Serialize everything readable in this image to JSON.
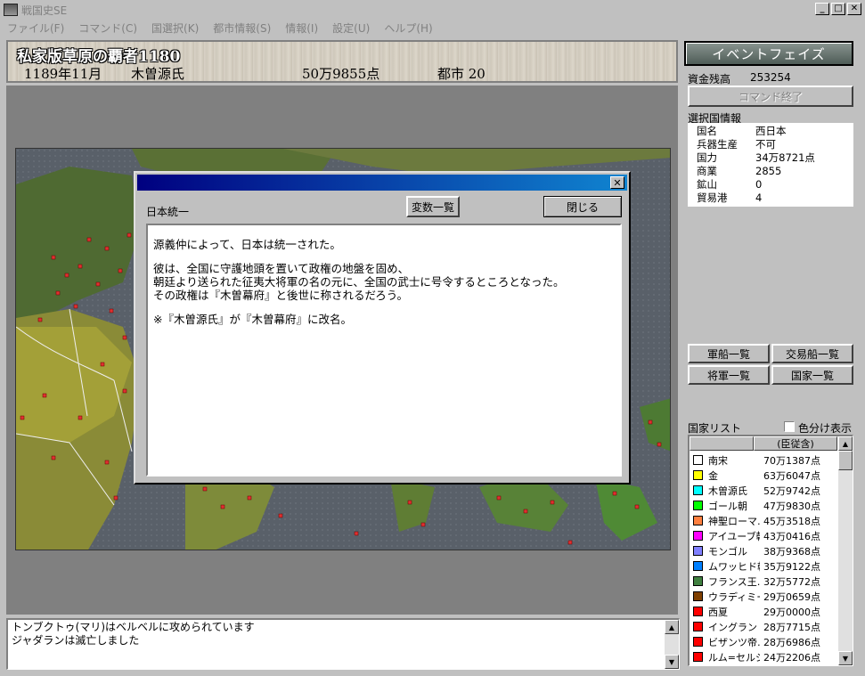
{
  "window": {
    "title": "戦国史SE"
  },
  "menu": [
    "ファイル(F)",
    "コマンド(C)",
    "国選択(K)",
    "都市情報(S)",
    "情報(I)",
    "設定(U)",
    "ヘルプ(H)"
  ],
  "header": {
    "scenario": "私家版草原の覇者1180",
    "date": "1189年11月",
    "clan": "木曽源氏",
    "score": "50万9855点",
    "cities": "都市 20"
  },
  "dialog": {
    "heading": "日本統一",
    "vars_button": "変数一覧",
    "close_button": "閉じる",
    "paragraphs": [
      "源義仲によって、日本は統一された。",
      "彼は、全国に守護地頭を置いて政権の地盤を固め、\n朝廷より送られた征夷大将軍の名の元に、全国の武士に号令するところとなった。\nその政権は『木曽幕府』と後世に称されるだろう。",
      "※『木曽源氏』が『木曽幕府』に改名。"
    ]
  },
  "log": {
    "lines": [
      "トンブクトゥ(マリ)はベルベルに攻められています",
      "ジャダランは滅亡しました"
    ]
  },
  "panel": {
    "phase": "イベントフェイズ",
    "funds_label": "資金残高",
    "funds_value": "253254",
    "end_command": "コマンド終了",
    "country_info_label": "選択国情報",
    "country_info": [
      {
        "key": "国名",
        "value": "西日本"
      },
      {
        "key": "兵器生産",
        "value": "不可"
      },
      {
        "key": "国力",
        "value": "34万8721点"
      },
      {
        "key": "商業",
        "value": "2855"
      },
      {
        "key": "鉱山",
        "value": "0"
      },
      {
        "key": "貿易港",
        "value": "4"
      }
    ],
    "buttons": {
      "warships": "軍船一覧",
      "tradeships": "交易船一覧",
      "generals": "将軍一覧",
      "countries": "国家一覧"
    },
    "country_list_label": "国家リスト",
    "color_toggle_label": "色分け表示",
    "list_header": "(臣従含)",
    "countries": [
      {
        "name": "南宋",
        "value": "70万1387点",
        "color": "#ffffff"
      },
      {
        "name": "金",
        "value": "63万6047点",
        "color": "#ffff00"
      },
      {
        "name": "木曽源氏",
        "value": "52万9742点",
        "color": "#00ffff"
      },
      {
        "name": "ゴール朝",
        "value": "47万9830点",
        "color": "#00ff00"
      },
      {
        "name": "神聖ローマ…",
        "value": "45万3518点",
        "color": "#ff8040"
      },
      {
        "name": "アイユーブ朝",
        "value": "43万0416点",
        "color": "#ff00ff"
      },
      {
        "name": "モンゴル",
        "value": "38万9368点",
        "color": "#8080ff"
      },
      {
        "name": "ムワッヒド朝",
        "value": "35万9122点",
        "color": "#0080ff"
      },
      {
        "name": "フランス王…",
        "value": "32万5772点",
        "color": "#408040"
      },
      {
        "name": "ウラディミー…",
        "value": "29万0659点",
        "color": "#804000"
      },
      {
        "name": "西夏",
        "value": "29万0000点",
        "color": "#ff0000"
      },
      {
        "name": "イングランド…",
        "value": "28万7715点",
        "color": "#ff0000"
      },
      {
        "name": "ビザンツ帝…",
        "value": "28万6986点",
        "color": "#ff0000"
      },
      {
        "name": "ルム=セルジ…",
        "value": "24万2206点",
        "color": "#ff0000"
      }
    ]
  }
}
